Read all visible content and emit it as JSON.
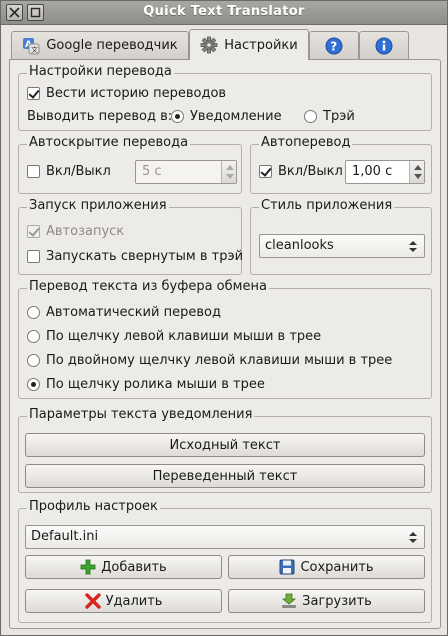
{
  "window": {
    "title": "Quick Text Translator"
  },
  "titlebar": {
    "close_icon": "close-icon",
    "menu_icon": "window-menu-icon"
  },
  "tabs": [
    {
      "label": "Google переводчик",
      "icon": "google-translate-icon",
      "active": false
    },
    {
      "label": "Настройки",
      "icon": "gear-icon",
      "active": true
    },
    {
      "label": "",
      "icon": "help-icon",
      "active": false
    },
    {
      "label": "",
      "icon": "info-icon",
      "active": false
    }
  ],
  "translation_settings": {
    "title": "Настройки перевода",
    "keep_history_label": "Вести историю переводов",
    "keep_history_checked": true,
    "output_label": "Выводить перевод в:",
    "output_options": [
      "Уведомление",
      "Трэй"
    ],
    "output_selected": "Уведомление"
  },
  "autohide": {
    "title": "Автоскрытие перевода",
    "toggle_label": "Вкл/Выкл",
    "checked": false,
    "value": "5 с"
  },
  "autotranslate": {
    "title": "Автоперевод",
    "toggle_label": "Вкл/Выкл",
    "checked": true,
    "value": "1,00 с"
  },
  "startup": {
    "title": "Запуск приложения",
    "autostart_label": "Автозапуск",
    "autostart_checked": true,
    "minimized_label": "Запускать свернутым в трэй",
    "minimized_checked": false
  },
  "app_style": {
    "title": "Стиль приложения",
    "selected": "cleanlooks"
  },
  "clipboard": {
    "title": "Перевод текста из буфера обмена",
    "options": [
      "Автоматический перевод",
      "По щелчку левой клавиши мыши в трее",
      "По двойному щелчку левой клавиши мыши в трее",
      "По щелчку ролика мыши в трее"
    ],
    "selected_index": 3
  },
  "notification_text": {
    "title": "Параметры текста уведомления",
    "source_button": "Исходный текст",
    "translated_button": "Переведенный текст"
  },
  "profile": {
    "title": "Профиль настроек",
    "selected": "Default.ini",
    "add_label": "Добавить",
    "save_label": "Сохранить",
    "delete_label": "Удалить",
    "load_label": "Загрузить"
  },
  "colors": {
    "title_bar": "#9c9a96",
    "window_bg": "#edebe7",
    "add_icon": "#3aa52e",
    "delete_icon": "#d6261c",
    "info_icon": "#2f6fd6"
  }
}
